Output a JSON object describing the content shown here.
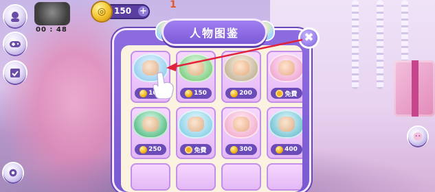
{
  "hud": {
    "timer": "00 : 48",
    "coins": "150",
    "coin_plus": "+",
    "level_number": "1"
  },
  "dialog": {
    "title": "人物图鉴",
    "close_symbol": "✖"
  },
  "cards": [
    {
      "price": "100",
      "currency": "coin",
      "shell_color": "#9ad0ef"
    },
    {
      "price": "150",
      "currency": "coin",
      "shell_color": "#86cf86"
    },
    {
      "price": "200",
      "currency": "coin",
      "shell_color": "#c5b59a"
    },
    {
      "price": "免費",
      "currency": "clock",
      "shell_color": "#f0a9d3"
    },
    {
      "price": "250",
      "currency": "coin",
      "shell_color": "#5fbf8a"
    },
    {
      "price": "免費",
      "currency": "clock",
      "shell_color": "#8fd2e8"
    },
    {
      "price": "300",
      "currency": "coin",
      "shell_color": "#f3b0cf"
    },
    {
      "price": "400",
      "currency": "coin",
      "shell_color": "#77c4d4"
    }
  ],
  "colors": {
    "panel": "#7a5ad0",
    "price_tag": "#6a4bb7",
    "arrow": "#e0223a"
  }
}
